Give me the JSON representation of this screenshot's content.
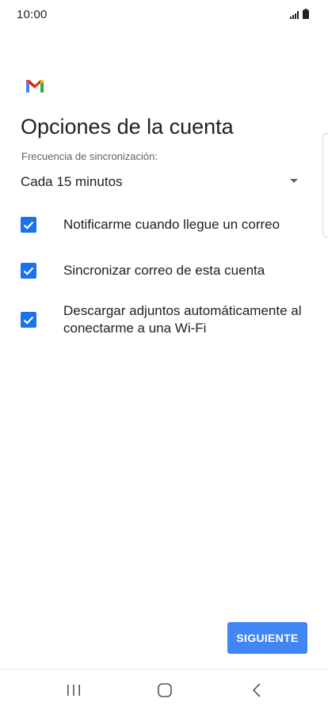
{
  "status_bar": {
    "time": "10:00",
    "icons": [
      "signal-icon",
      "battery-icon"
    ]
  },
  "app": {
    "logo": "gmail-logo"
  },
  "page": {
    "title": "Opciones de la cuenta"
  },
  "sync_frequency": {
    "label": "Frecuencia de sincronización:",
    "selected": "Cada 15 minutos"
  },
  "options": [
    {
      "label": "Notificarme cuando llegue un correo",
      "checked": true
    },
    {
      "label": "Sincronizar correo de esta cuenta",
      "checked": true
    },
    {
      "label": "Descargar adjuntos automáticamente al conectarme a una Wi-Fi",
      "checked": true
    }
  ],
  "actions": {
    "next_label": "SIGUIENTE"
  },
  "navigation": {
    "buttons": [
      "recent-apps-icon",
      "home-icon",
      "back-icon"
    ]
  },
  "colors": {
    "accent": "#4285f4",
    "checkbox": "#1a73e8"
  }
}
